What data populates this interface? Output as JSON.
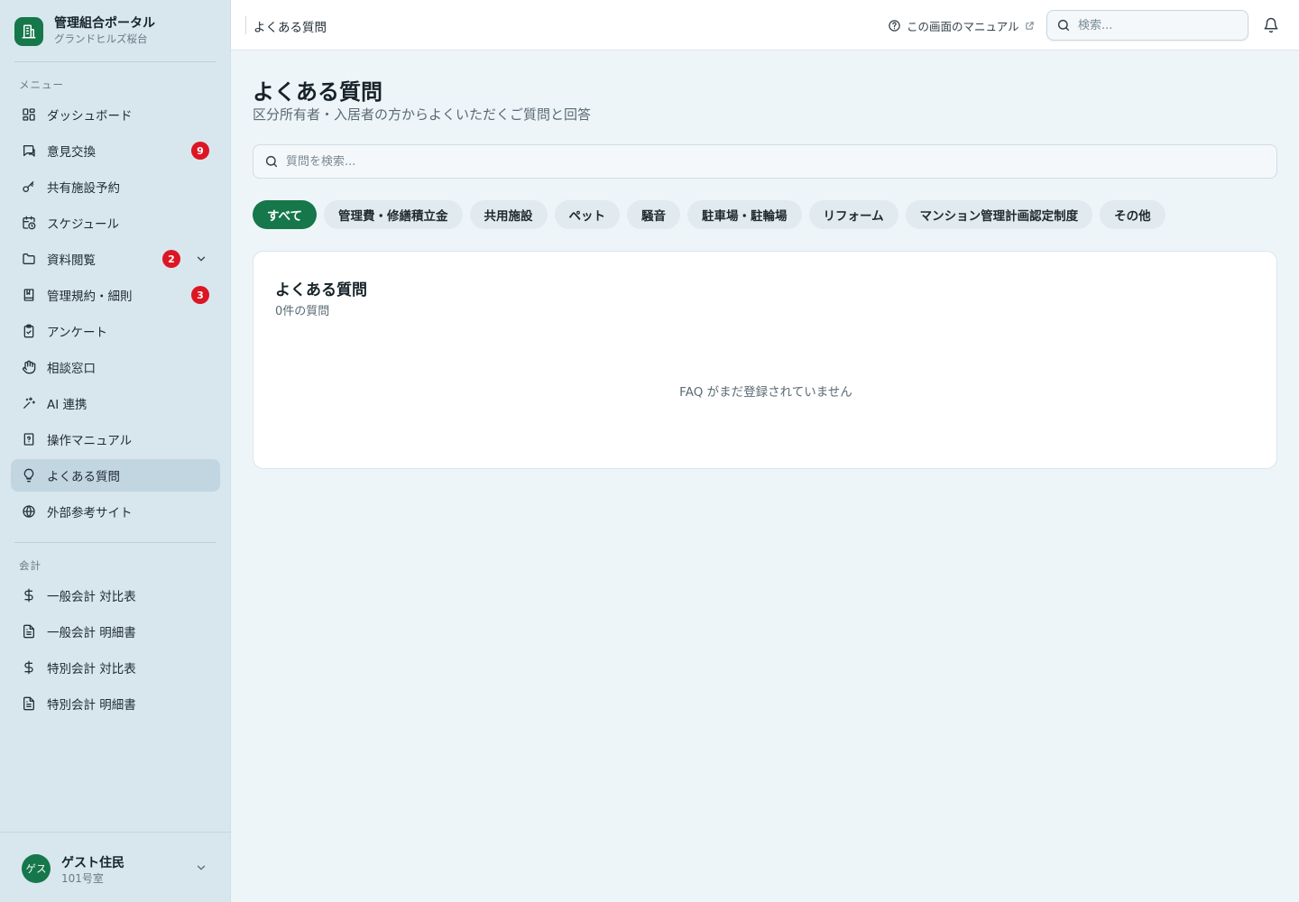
{
  "brand": {
    "title": "管理組合ポータル",
    "subtitle": "グランドヒルズ桜台"
  },
  "sidebar": {
    "menu_heading": "メニュー",
    "items": [
      {
        "label": "ダッシュボード",
        "icon": "dashboard-icon"
      },
      {
        "label": "意見交換",
        "icon": "chat-icon",
        "badge": "9"
      },
      {
        "label": "共有施設予約",
        "icon": "key-icon"
      },
      {
        "label": "スケジュール",
        "icon": "calendar-clock-icon"
      },
      {
        "label": "資料閲覧",
        "icon": "folder-icon",
        "badge": "2",
        "expandable": true
      },
      {
        "label": "管理規約・細則",
        "icon": "book-icon",
        "badge": "3"
      },
      {
        "label": "アンケート",
        "icon": "clipboard-check-icon"
      },
      {
        "label": "相談窓口",
        "icon": "hand-icon"
      },
      {
        "label": "AI 連携",
        "icon": "sparkle-icon"
      },
      {
        "label": "操作マニュアル",
        "icon": "manual-book-icon"
      },
      {
        "label": "よくある質問",
        "icon": "lightbulb-icon",
        "active": true
      },
      {
        "label": "外部参考サイト",
        "icon": "globe-icon"
      }
    ],
    "accounting_heading": "会計",
    "accounting_items": [
      {
        "label": "一般会計 対比表",
        "icon": "dollar-icon"
      },
      {
        "label": "一般会計 明細書",
        "icon": "document-icon"
      },
      {
        "label": "特別会計 対比表",
        "icon": "dollar-icon"
      },
      {
        "label": "特別会計 明細書",
        "icon": "document-icon"
      }
    ]
  },
  "user": {
    "avatar_text": "ゲス",
    "name": "ゲスト住民",
    "room": "101号室"
  },
  "header": {
    "breadcrumb": "よくある質問",
    "manual_link": "この画面のマニュアル",
    "search_placeholder": "検索..."
  },
  "main": {
    "title": "よくある質問",
    "subtitle": "区分所有者・入居者の方からよくいただくご質問と回答",
    "search_placeholder": "質問を検索...",
    "categories": [
      "すべて",
      "管理費・修繕積立金",
      "共用施設",
      "ペット",
      "騒音",
      "駐車場・駐輪場",
      "リフォーム",
      "マンション管理計画認定制度",
      "その他"
    ],
    "active_category": "すべて",
    "card": {
      "title": "よくある質問",
      "count": "0件の質問",
      "empty_message": "FAQ がまだ登録されていません"
    }
  },
  "colors": {
    "accent": "#15774a",
    "badge": "#dc1623",
    "sidebar_bg": "#d8e6ee",
    "page_bg": "#eef5f8"
  }
}
